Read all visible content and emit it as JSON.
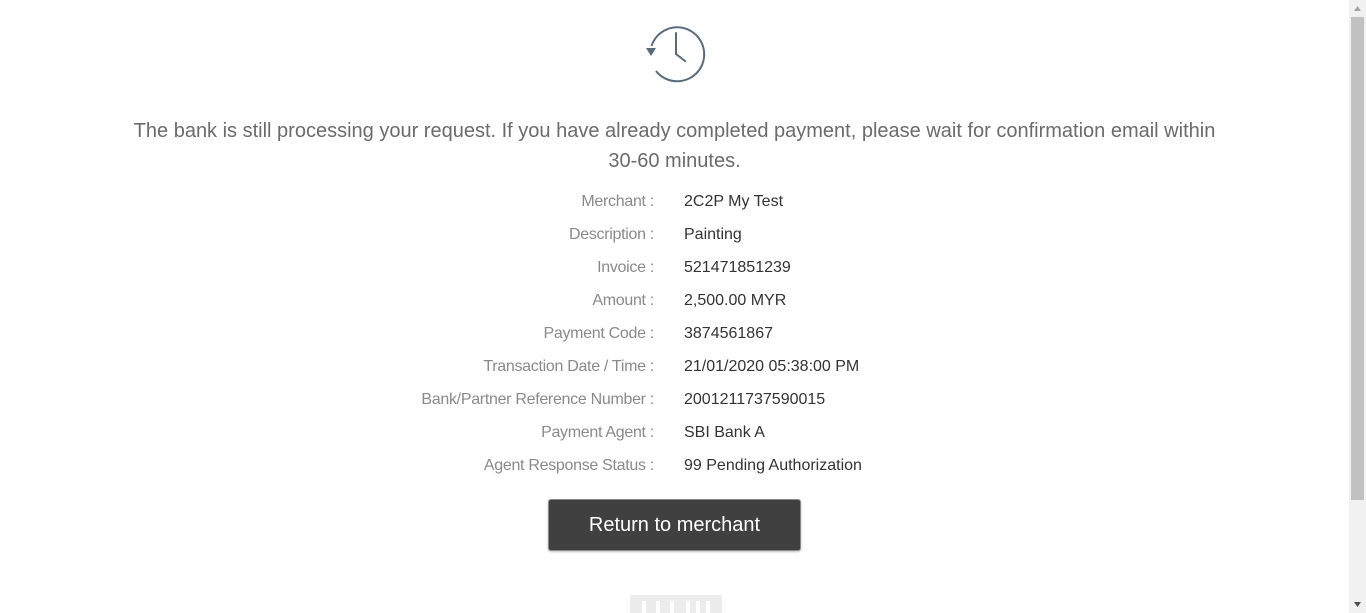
{
  "status": {
    "icon": "clock-history-icon",
    "message": "The bank is still processing your request. If you have already completed payment, please wait for confirmation email within 30-60 minutes."
  },
  "details": [
    {
      "label": "Merchant :",
      "value": "2C2P My Test"
    },
    {
      "label": "Description :",
      "value": "Painting"
    },
    {
      "label": "Invoice :",
      "value": "521471851239"
    },
    {
      "label": "Amount :",
      "value": "2,500.00 MYR"
    },
    {
      "label": "Payment Code :",
      "value": "3874561867"
    },
    {
      "label": "Transaction Date / Time :",
      "value": "21/01/2020 05:38:00 PM"
    },
    {
      "label": "Bank/Partner Reference Number :",
      "value": "2001211737590015"
    },
    {
      "label": "Payment Agent :",
      "value": "SBI Bank A"
    },
    {
      "label": "Agent Response Status :",
      "value": "99 Pending Authorization"
    }
  ],
  "actions": {
    "return_label": "Return to merchant"
  },
  "colors": {
    "button_bg": "#404040",
    "label_text": "#8a8a8a",
    "value_text": "#333333",
    "message_text": "#6b6b6b",
    "icon_stroke": "#5a6b7b"
  }
}
